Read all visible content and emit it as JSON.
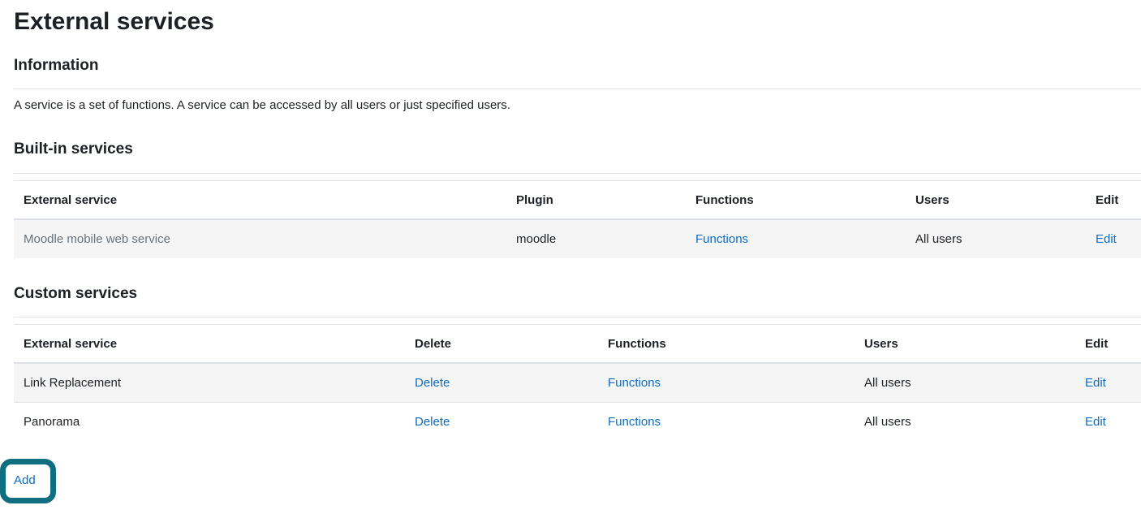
{
  "page": {
    "title": "External services"
  },
  "information": {
    "heading": "Information",
    "text": "A service is a set of functions. A service can be accessed by all users or just specified users."
  },
  "builtin": {
    "heading": "Built-in services",
    "columns": [
      "External service",
      "Plugin",
      "Functions",
      "Users",
      "Edit"
    ],
    "rows": [
      {
        "service": "Moodle mobile web service",
        "plugin": "moodle",
        "functions": "Functions",
        "users": "All users",
        "edit": "Edit"
      }
    ]
  },
  "custom": {
    "heading": "Custom services",
    "columns": [
      "External service",
      "Delete",
      "Functions",
      "Users",
      "Edit"
    ],
    "rows": [
      {
        "service": "Link Replacement",
        "delete": "Delete",
        "functions": "Functions",
        "users": "All users",
        "edit": "Edit"
      },
      {
        "service": "Panorama",
        "delete": "Delete",
        "functions": "Functions",
        "users": "All users",
        "edit": "Edit"
      }
    ]
  },
  "actions": {
    "add_label": "Add"
  },
  "colors": {
    "link": "#0f6cbf",
    "highlight_border": "#0f6e7f",
    "row_stripe": "#f5f5f5",
    "dimmed_text": "#6a737b"
  }
}
